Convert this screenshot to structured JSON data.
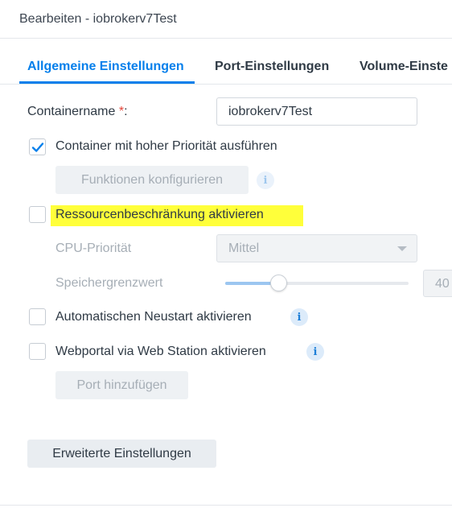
{
  "window": {
    "title": "Bearbeiten - iobrokerv7Test"
  },
  "tabs": [
    {
      "label": "Allgemeine Einstellungen",
      "active": true
    },
    {
      "label": "Port-Einstellungen",
      "active": false
    },
    {
      "label": "Volume-Einste",
      "active": false
    }
  ],
  "form": {
    "container_name_label": "Containername",
    "required_mark": "*",
    "colon": ":",
    "container_name_value": "iobrokerv7Test",
    "high_priority_label": "Container mit hoher Priorität ausführen",
    "high_priority_checked": true,
    "configure_functions_label": "Funktionen konfigurieren",
    "resource_limit_label": "Ressourcenbeschränkung aktivieren",
    "resource_limit_checked": false,
    "cpu_priority_label": "CPU-Priorität",
    "cpu_priority_value": "Mittel",
    "memory_limit_label": "Speichergrenzwert",
    "memory_limit_value": "40",
    "memory_slider_level": 0.25,
    "auto_restart_label": "Automatischen Neustart aktivieren",
    "auto_restart_checked": false,
    "webportal_label": "Webportal via Web Station aktivieren",
    "webportal_checked": false,
    "add_port_label": "Port hinzufügen",
    "advanced_settings_label": "Erweiterte Einstellungen"
  },
  "icons": {
    "info": "i",
    "check": "checkmark-icon"
  },
  "colors": {
    "accent": "#057feb",
    "highlight": "#ffff3a",
    "required": "#e5473b"
  }
}
